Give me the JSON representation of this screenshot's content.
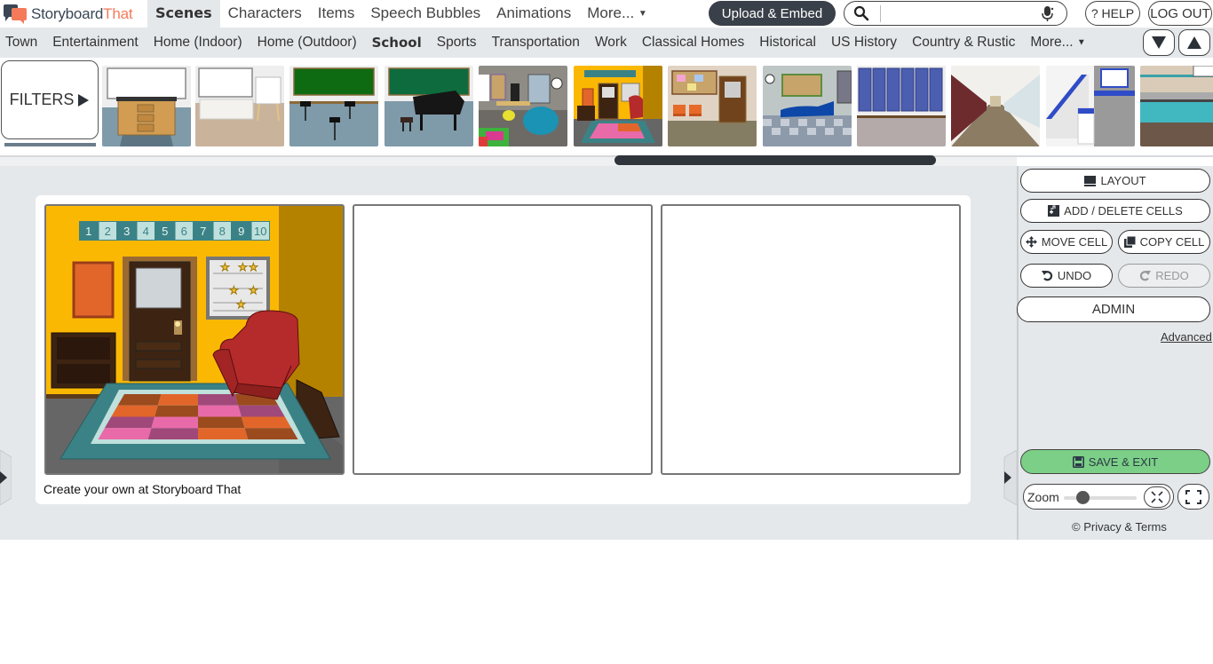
{
  "app": {
    "logo_text_main": "Storyboard",
    "logo_text_accent": "That",
    "brand_colors": {
      "dark": "#3a4655",
      "accent": "#f47a5a"
    }
  },
  "topnav": {
    "items": [
      {
        "label": "Scenes",
        "active": true
      },
      {
        "label": "Characters",
        "active": false
      },
      {
        "label": "Items",
        "active": false
      },
      {
        "label": "Speech Bubbles",
        "active": false
      },
      {
        "label": "Animations",
        "active": false
      },
      {
        "label": "More...",
        "active": false
      }
    ],
    "upload_label": "Upload & Embed",
    "search_placeholder": "",
    "help_label": "? HELP",
    "logout_label": "LOG OUT"
  },
  "categories": {
    "items": [
      {
        "label": "Town"
      },
      {
        "label": "Entertainment"
      },
      {
        "label": "Home (Indoor)"
      },
      {
        "label": "Home (Outdoor)"
      },
      {
        "label": "School",
        "active": true
      },
      {
        "label": "Sports"
      },
      {
        "label": "Transportation"
      },
      {
        "label": "Work"
      },
      {
        "label": "Classical Homes"
      },
      {
        "label": "Historical"
      },
      {
        "label": "US History"
      },
      {
        "label": "Country & Rustic"
      },
      {
        "label": "More..."
      }
    ]
  },
  "scene_strip": {
    "filters_label": "FILTERS",
    "thumbnails": [
      {
        "name": "science-lab-cabinet"
      },
      {
        "name": "art-room-easel"
      },
      {
        "name": "music-room-stands"
      },
      {
        "name": "music-room-piano"
      },
      {
        "name": "kindergarten-classroom"
      },
      {
        "name": "yellow-room-armchair"
      },
      {
        "name": "office-waiting-chairs"
      },
      {
        "name": "nurse-office"
      },
      {
        "name": "lockers"
      },
      {
        "name": "hallway"
      },
      {
        "name": "stairwell"
      },
      {
        "name": "cafeteria"
      }
    ],
    "scroll_position": 0.6
  },
  "storyboard": {
    "caption": "Create your own at Storyboard That",
    "cells": [
      {
        "scene": "yellow-room-armchair",
        "number_strip": [
          "1",
          "2",
          "3",
          "4",
          "5",
          "6",
          "7",
          "8",
          "9",
          "10"
        ]
      },
      {
        "scene": "empty"
      },
      {
        "scene": "empty"
      }
    ]
  },
  "panel": {
    "layout_label": "LAYOUT",
    "add_delete_label": "ADD / DELETE CELLS",
    "move_label": "MOVE CELL",
    "copy_label": "COPY CELL",
    "undo_label": "UNDO",
    "redo_label": "REDO",
    "admin_label": "ADMIN",
    "advanced_label": "Advanced",
    "save_label": "SAVE & EXIT",
    "zoom_label": "Zoom",
    "zoom_level": 0.25,
    "privacy_label": "© Privacy & Terms"
  }
}
